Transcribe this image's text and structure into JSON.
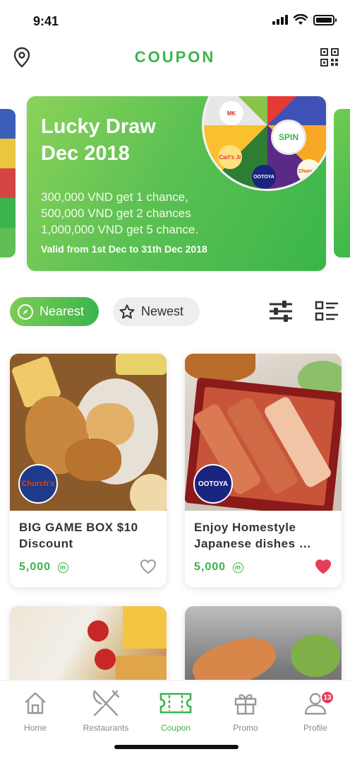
{
  "status": {
    "time": "9:41"
  },
  "header": {
    "title": "COUPON",
    "left_icon": "location-pin-icon",
    "right_icon": "qr-code-icon"
  },
  "banner": {
    "title_line1": "Lucky Draw",
    "title_line2": "Dec 2018",
    "lines": [
      "300,000 VND get 1 chance,",
      "500,000 VND get 2 chances",
      "1,000,000 VND get 5 chance."
    ],
    "valid": "Valid from 1st Dec to 31th Dec 2018",
    "spin_label": "SPIN",
    "wheel_logos": [
      "MK",
      "Carl's Jr",
      "OOTOYA",
      "Church's"
    ]
  },
  "filters": {
    "nearest": "Nearest",
    "newest": "Newest",
    "active": "Nearest"
  },
  "cards": [
    {
      "title": "BIG GAME BOX $10 Discount",
      "points": "5,000",
      "coin": "m",
      "brand": "Church's",
      "favorited": false
    },
    {
      "title": "Enjoy Homestyle Japanese dishes …",
      "points": "5,000",
      "coin": "m",
      "brand": "OOTOYA",
      "favorited": true
    }
  ],
  "tabs": [
    {
      "label": "Home",
      "icon": "home-icon"
    },
    {
      "label": "Restaurants",
      "icon": "fork-knife-icon"
    },
    {
      "label": "Coupon",
      "icon": "ticket-icon",
      "active": true
    },
    {
      "label": "Promo",
      "icon": "gift-icon"
    },
    {
      "label": "Profile",
      "icon": "user-icon",
      "badge": "13"
    }
  ],
  "colors": {
    "accent": "#3cb44b",
    "heart": "#e63d59"
  }
}
